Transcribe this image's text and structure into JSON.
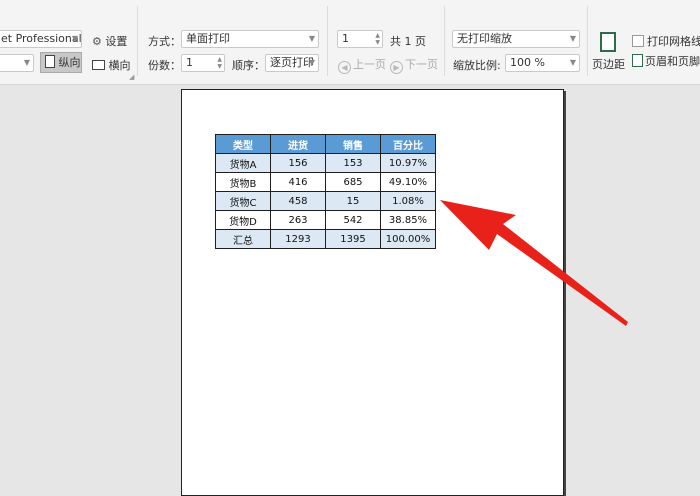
{
  "toolbar": {
    "printer_select": "et Professional",
    "portrait_label": "纵向",
    "landscape_label": "横向",
    "settings_label": "设置",
    "mode_label": "方式：",
    "mode_value": "单面打印",
    "copies_label": "份数：",
    "copies_value": "1",
    "order_label": "顺序：",
    "order_value": "逐页打印",
    "page_input": "1",
    "total_pages": "共 1 页",
    "prev_page": "上一页",
    "next_page": "下一页",
    "scale_select": "无打印缩放",
    "zoom_label": "缩放比例:",
    "zoom_value": "100 %",
    "margins_label": "页边距",
    "gridlines_label": "打印网格线",
    "header_footer_label": "页眉和页脚"
  },
  "sheet": {
    "headers": [
      "类型",
      "进货",
      "销售",
      "百分比"
    ],
    "rows": [
      [
        "货物A",
        "156",
        "153",
        "10.97%"
      ],
      [
        "货物B",
        "416",
        "685",
        "49.10%"
      ],
      [
        "货物C",
        "458",
        "15",
        "1.08%"
      ],
      [
        "货物D",
        "263",
        "542",
        "38.85%"
      ],
      [
        "汇总",
        "1293",
        "1395",
        "100.00%"
      ]
    ]
  },
  "colors": {
    "header_bg": "#5b9bd5",
    "alt_row_bg": "#dce9f5",
    "arrow": "#e8221b"
  }
}
